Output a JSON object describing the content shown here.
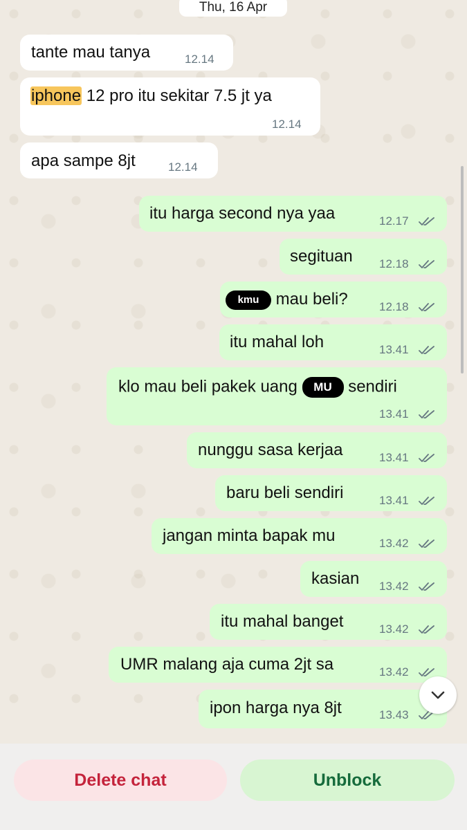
{
  "date_label": "Thu, 16 Apr",
  "messages": [
    {
      "type": "in",
      "text": "tante mau tanya",
      "time": "12.14"
    },
    {
      "type": "in",
      "highlight": "iphone",
      "text": " 12 pro itu sekitar 7.5 jt ya",
      "time": "12.14"
    },
    {
      "type": "in",
      "text": "apa sampe 8jt",
      "time": "12.14"
    },
    {
      "type": "out",
      "text": "itu harga second nya yaa",
      "time": "12.17",
      "status": "read"
    },
    {
      "type": "out",
      "text": "segituan",
      "time": "12.18",
      "status": "read"
    },
    {
      "type": "out",
      "redacted_label": "kmu",
      "text": "mau beli?",
      "time": "12.18",
      "status": "read"
    },
    {
      "type": "out",
      "text": "itu mahal loh",
      "time": "13.41",
      "status": "read"
    },
    {
      "type": "out",
      "text_before": "klo mau beli pakek uang",
      "redacted_label": "MU",
      "text_after": "sendiri",
      "time": "13.41",
      "status": "read"
    },
    {
      "type": "out",
      "text": "nunggu sasa kerjaa",
      "time": "13.41",
      "status": "read"
    },
    {
      "type": "out",
      "text": "baru beli sendiri",
      "time": "13.41",
      "status": "read"
    },
    {
      "type": "out",
      "text": "jangan minta bapak mu",
      "time": "13.42",
      "status": "read"
    },
    {
      "type": "out",
      "text": "kasian",
      "time": "13.42",
      "status": "read"
    },
    {
      "type": "out",
      "text": "itu mahal banget",
      "time": "13.42",
      "status": "read"
    },
    {
      "type": "out",
      "text": "UMR malang aja cuma 2jt sa",
      "time": "13.42",
      "status": "read"
    },
    {
      "type": "out",
      "text": "ipon harga nya 8jt",
      "time": "13.43",
      "status": "read"
    }
  ],
  "actions": {
    "delete_label": "Delete chat",
    "unblock_label": "Unblock"
  },
  "icons": {
    "scroll_down": "chevron-down-icon",
    "read_receipt": "double-check-icon"
  },
  "colors": {
    "chat_background": "#efeae2",
    "incoming_bubble": "#ffffff",
    "outgoing_bubble": "#d9fdd3",
    "highlight": "#f7c65c",
    "delete_text": "#c4233b",
    "delete_bg": "#fbe4e6",
    "unblock_text": "#166b3c",
    "unblock_bg": "#d8f5d2"
  }
}
